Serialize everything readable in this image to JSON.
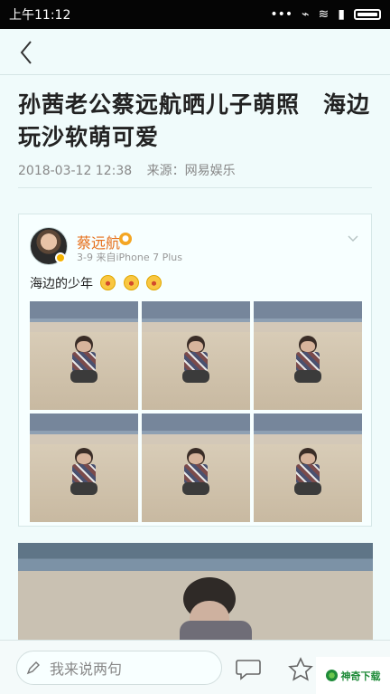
{
  "status_bar": {
    "time": "上午11:12",
    "icons": [
      "dots-icon",
      "vibrate-icon",
      "wifi-icon",
      "signal-icon",
      "battery-icon"
    ]
  },
  "navigation": {
    "back_icon": "back-arrow-icon"
  },
  "article": {
    "title": "孙茜老公蔡远航晒儿子萌照　海边玩沙软萌可爱",
    "date": "2018-03-12 12:38",
    "source": "来源：网易娱乐"
  },
  "weibo_post": {
    "author_name": "蔡远航",
    "post_meta": "3-9  来自iPhone 7 Plus",
    "text": "海边的少年",
    "emoji_count": 3,
    "photo_count": 6
  },
  "bottom_bar": {
    "comment_placeholder": "我来说两句",
    "comment_icon": "comment-icon",
    "star_icon": "star-icon"
  },
  "watermark": {
    "text": "神奇下载"
  }
}
